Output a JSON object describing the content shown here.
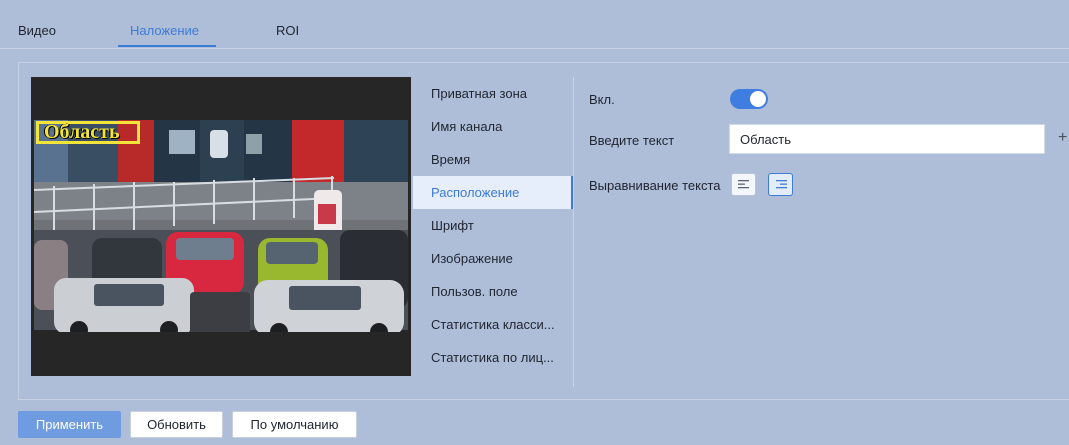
{
  "tabs": [
    {
      "label": "Видео"
    },
    {
      "label": "Наложение",
      "active": true
    },
    {
      "label": "ROI"
    }
  ],
  "preview": {
    "overlay_text": "Область",
    "overlay_color": "#f3e43a"
  },
  "menu": {
    "items": [
      {
        "label": "Приватная зона"
      },
      {
        "label": "Имя канала"
      },
      {
        "label": "Время"
      },
      {
        "label": "Расположение",
        "active": true
      },
      {
        "label": "Шрифт"
      },
      {
        "label": "Изображение"
      },
      {
        "label": "Пользов. поле"
      },
      {
        "label": "Статистика класси..."
      },
      {
        "label": "Статистика по лиц..."
      }
    ]
  },
  "settings": {
    "enable_label": "Вкл.",
    "enabled": true,
    "text_label": "Введите текст",
    "text_value": "Область",
    "add_icon": "plus-icon",
    "align_label": "Выравнивание текста",
    "align_options": [
      "align-left-icon",
      "align-right-icon"
    ],
    "align_selected": "right"
  },
  "buttons": {
    "apply": "Применить",
    "refresh": "Обновить",
    "default": "По умолчанию"
  },
  "colors": {
    "accent": "#3c7bd6",
    "background": "#aebed8",
    "primary_button": "#6f9be0"
  }
}
